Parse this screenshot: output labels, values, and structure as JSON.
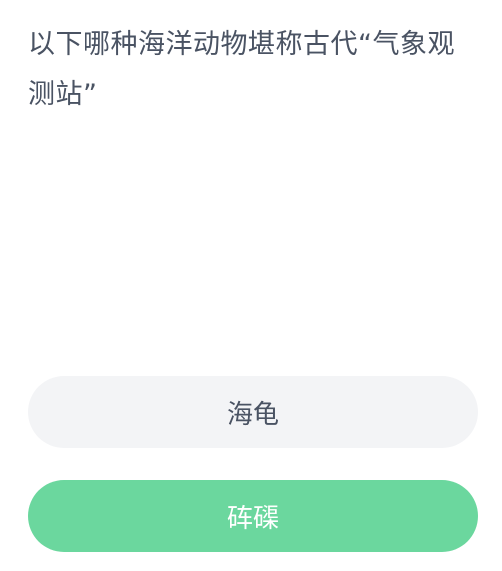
{
  "question": {
    "text": "以下哪种海洋动物堪称古代“气象观测站”"
  },
  "options": [
    {
      "label": "海龟",
      "state": "default",
      "bg_color": "#f3f4f6",
      "text_color": "#4a5363"
    },
    {
      "label": "砗磲",
      "state": "selected-correct",
      "bg_color": "#6bd79e",
      "text_color": "#ffffff"
    }
  ]
}
